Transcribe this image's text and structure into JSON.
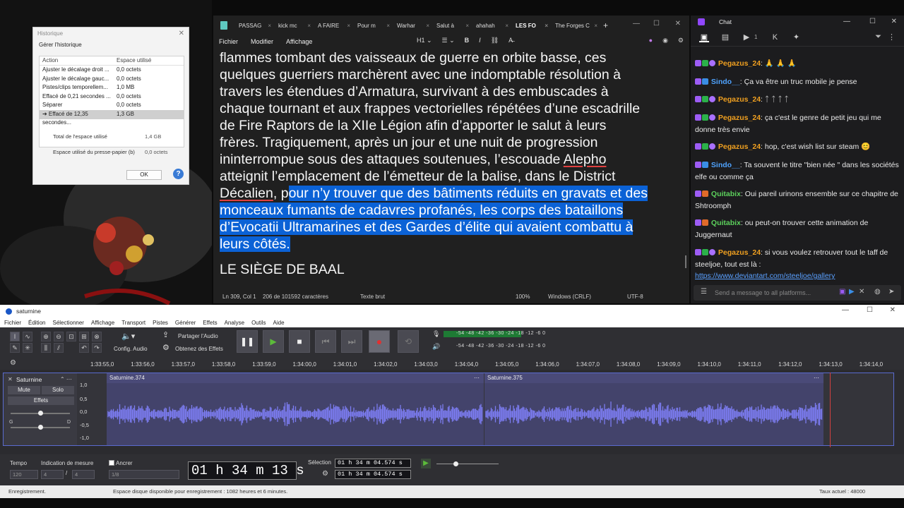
{
  "history": {
    "title": "Historique",
    "subtitle": "Gérer l'historique",
    "col_action": "Action",
    "col_space": "Espace utilisé",
    "rows": [
      {
        "action": "Ajuster le décalage droit ...",
        "space": "0,0 octets"
      },
      {
        "action": "Ajuster le décalage gauc...",
        "space": "0,0 octets"
      },
      {
        "action": "Pistes/clips temporellem...",
        "space": "1,0 MB"
      },
      {
        "action": "Effacé de 0,21 secondes ...",
        "space": "0,0 octets"
      },
      {
        "action": "Séparer",
        "space": "0,0 octets"
      },
      {
        "action": "➔ Effacé de 12,35 secondes...",
        "space": "1,3 GB"
      }
    ],
    "total_label": "Total de l'espace utilisé",
    "total_value": "1,4 GB",
    "clipboard_label": "Espace utilisé du presse-papier (b)",
    "clipboard_value": "0,0 octets",
    "ok_label": "OK",
    "help_label": "?"
  },
  "notepad": {
    "tabs": [
      "PASSAG",
      "kick mc",
      "A FAIRE",
      "Pour m",
      "Warhar",
      "Salut à",
      "ahahah",
      "LES FO",
      "The Forges C"
    ],
    "active_tab": 7,
    "menu": [
      "Fichier",
      "Modifier",
      "Affichage"
    ],
    "format_buttons": [
      "H1 ⌄",
      "☰ ⌄",
      "B",
      "I",
      "⛓",
      "A̶"
    ],
    "lines": [
      "flammes tombant des vaisseaux de guerre en orbite basse, ces",
      "quelques guerriers marchèrent avec une indomptable résolution à",
      "travers les étendues d’Armatura, survivant à des embuscades à",
      "chaque tournant et aux frappes vectorielles répétées d’une escadrille",
      "de Fire Raptors de la XIIe Légion afin d’apporter le salut à leurs",
      "frères. Tragiquement, après un jour et une nuit de progression",
      "ininterrompue sous des attaques soutenues, l’escouade ",
      "atteignit l’emplacement de l’émetteur de la balise, dans le District"
    ],
    "spell_word": "Alepho",
    "line9_pre": "Décalien",
    "line9_mid": ", p",
    "line9_hl": "our n’y trouver que des bâtiments réduits en gravats et des",
    "hl_lines": [
      "monceaux fumants de cadavres profanés, les corps des bataillons",
      "d’Evocatii Ultramarines et des Gardes d’élite qui avaient combattu à",
      "leurs côtés."
    ],
    "heading": "LE SIÈGE DE BAAL",
    "status": {
      "position": "Ln 309, Col 1",
      "chars": "206 de 101592 caractères",
      "mode": "Texte brut",
      "zoom": "100%",
      "eol": "Windows (CRLF)",
      "encoding": "UTF-8"
    }
  },
  "chat": {
    "title": "Chat",
    "viewer_count": "1",
    "input_placeholder": "Send a message to all platforms...",
    "messages": [
      {
        "user": "Pegazus_24",
        "sep": ":",
        "text": " 🙏 🙏 🙏",
        "color": "peg"
      },
      {
        "user": "Sindo__",
        "sep": ":",
        "text": " Ça va être un truc mobile je pense",
        "color": "sin"
      },
      {
        "user": "Pegazus_24",
        "sep": ":",
        "text": "  ᛏ  ᛏ  ᛏ  ᛏ",
        "color": "peg"
      },
      {
        "user": "Pegazus_24",
        "sep": ":",
        "text": " ça c'est le genre de petit jeu qui me donne très envie",
        "color": "peg"
      },
      {
        "user": "Pegazus_24",
        "sep": ":",
        "text": " hop, c'est wish list sur steam 😊",
        "color": "peg"
      },
      {
        "user": "Sindo__",
        "sep": ":",
        "text": " Ta souvent le titre \"bien née \" dans les sociétés elfe ou comme ça",
        "color": "sin"
      },
      {
        "user": "Quitabix",
        "sep": ":",
        "text": " Oui pareil urinons ensemble sur ce chapitre de Shtroomph",
        "color": "qui"
      },
      {
        "user": "Quitabix",
        "sep": ":",
        "text": " ou peut-on trouver cette animation de Juggernaut",
        "color": "qui"
      },
      {
        "user": "Pegazus_24",
        "sep": ":",
        "text": " si vous voulez retrouver tout le taff de steeljoe, tout est là :",
        "color": "peg"
      }
    ],
    "link": "https://www.deviantart.com/steeljoe/gallery"
  },
  "audacity": {
    "title": "saturnine",
    "menu": [
      "Fichier",
      "Édition",
      "Sélectionner",
      "Affichage",
      "Transport",
      "Pistes",
      "Générer",
      "Effets",
      "Analyse",
      "Outils",
      "Aide"
    ],
    "config_audio": "Config. Audio",
    "share_audio": "Partager l'Audio",
    "get_effects": "Obtenez des Effets",
    "meter_scale": "-54  -48  -42  -36  -30  -24  -18  -12   -6    0",
    "ruler": [
      "1:33:55,0",
      "1:33:56,0",
      "1:33:57,0",
      "1:33:58,0",
      "1:33:59,0",
      "1:34:00,0",
      "1:34:01,0",
      "1:34:02,0",
      "1:34:03,0",
      "1:34:04,0",
      "1:34:05,0",
      "1:34:06,0",
      "1:34:07,0",
      "1:34:08,0",
      "1:34:09,0",
      "1:34:10,0",
      "1:34:11,0",
      "1:34:12,0",
      "1:34:13,0",
      "1:34:14,0"
    ],
    "track_name": "Saturnine",
    "mute": "Mute",
    "solo": "Solo",
    "effects": "Effets",
    "pan_left": "G",
    "pan_right": "D",
    "scale": [
      "1,0",
      "0,5",
      "0,0",
      "-0,5",
      "-1,0"
    ],
    "clip1": "Saturnine.374",
    "clip2": "Saturnine.375",
    "tempo_label": "Tempo",
    "tempo_value": "120",
    "meter_label": "Indication de mesure",
    "meter_num": "4",
    "meter_den": "4",
    "anchor_label": "Ancrer",
    "snap_value": "1/8",
    "time_display": "01 h 34 m 13 s",
    "selection_label": "Sélection",
    "sel_start": "01 h 34 m 04.574 s",
    "sel_end": "01 h 34 m 04.574 s",
    "status_left": "Enregistrement.",
    "status_mid": "Espace disque disponible pour enregistrement : 1082 heures et 6 minutes.",
    "status_right": "Taux actuel : 48000"
  }
}
